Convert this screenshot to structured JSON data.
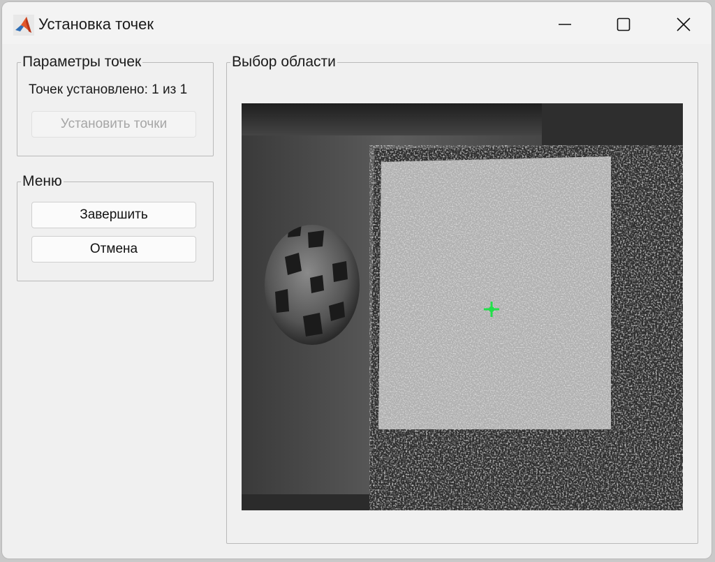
{
  "window": {
    "title": "Установка точек",
    "app_icon": "matlab-logo-icon",
    "controls": [
      "minimize-icon",
      "maximize-icon",
      "close-icon"
    ]
  },
  "params_panel": {
    "title": "Параметры точек",
    "points_status": "Точек установлено: 1 из 1",
    "set_points_label": "Установить точки",
    "set_points_enabled": false
  },
  "menu_panel": {
    "title": "Меню",
    "finish_label": "Завершить",
    "cancel_label": "Отмена"
  },
  "area_panel": {
    "title": "Выбор области",
    "marker_color": "#22e04a"
  },
  "colors": {
    "window_bg": "#f0f0f0",
    "border": "#b9b9b9",
    "disabled_text": "#a6a6a6"
  }
}
